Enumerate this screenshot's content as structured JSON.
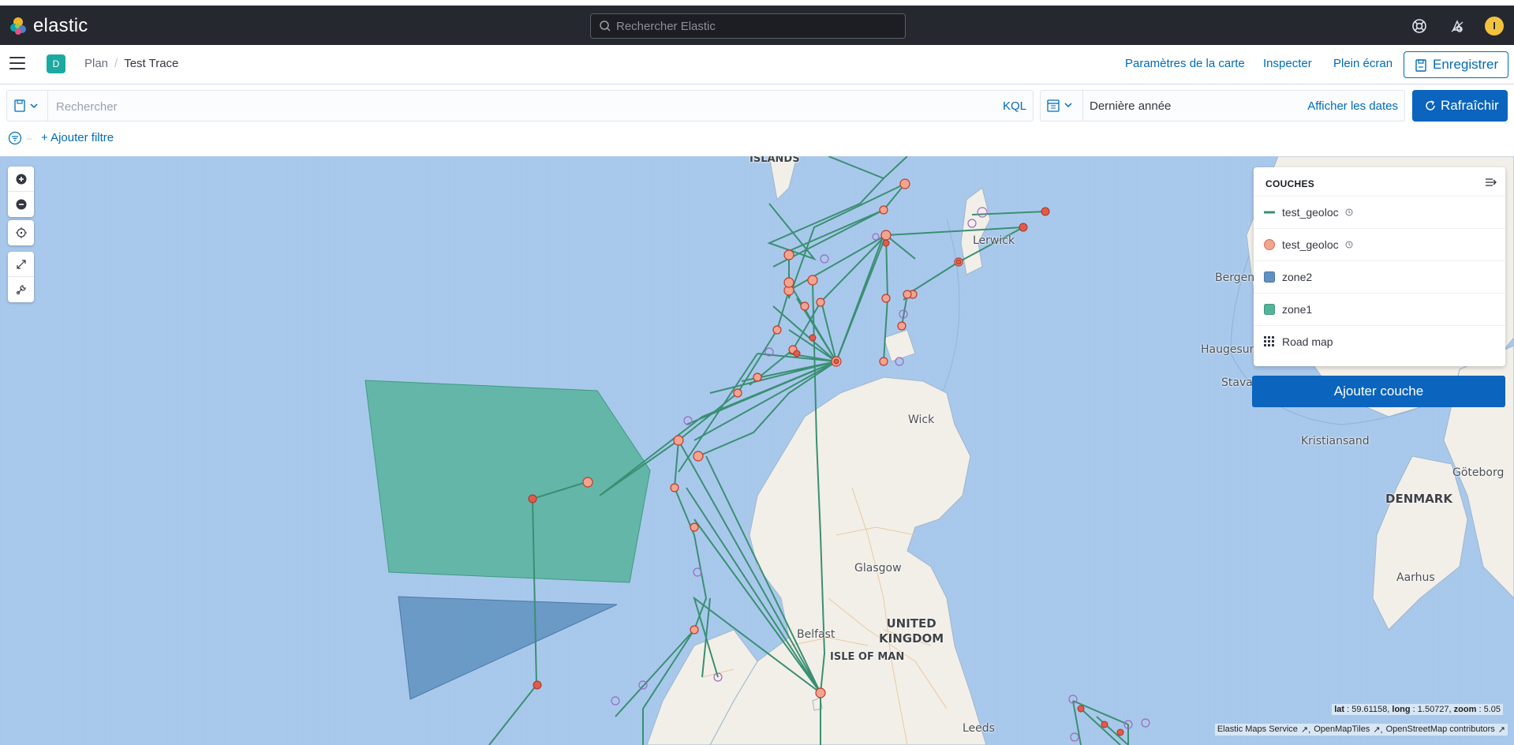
{
  "app": {
    "brand": "elastic",
    "search_placeholder": "Rechercher Elastic",
    "avatar_initial": "I",
    "space_initial": "D"
  },
  "breadcrumb": {
    "parent": "Plan",
    "current": "Test Trace"
  },
  "header_actions": {
    "map_settings": "Paramètres de la carte",
    "inspect": "Inspecter",
    "fullscreen": "Plein écran",
    "save": "Enregistrer"
  },
  "query": {
    "placeholder": "Rechercher",
    "language": "KQL",
    "date_range": "Dernière année",
    "show_dates": "Afficher les dates",
    "refresh": "Rafraîchir",
    "add_filter": "+ Ajouter filtre"
  },
  "map": {
    "layers_title": "COUCHES",
    "layers": [
      {
        "name": "test_geoloc",
        "icon": "line-icon",
        "time_aware": true
      },
      {
        "name": "test_geoloc",
        "icon": "point-icon",
        "time_aware": true
      },
      {
        "name": "zone2",
        "icon": "polygon-icon"
      },
      {
        "name": "zone1",
        "icon": "polygon-icon"
      },
      {
        "name": "Road map",
        "icon": "grid-icon"
      }
    ],
    "add_layer": "Ajouter couche",
    "colors": {
      "zone1": "#54b399",
      "zone2": "#6092c0",
      "track": "#3a8f73",
      "point_fill": "#f0a58f",
      "water": "#a9c9ec",
      "land": "#f2efe8"
    },
    "place_labels": {
      "islands": "ISLANDS",
      "lerwick": "Lerwick",
      "bergen": "Bergen",
      "haugesund": "Haugesun",
      "stavanger": "Stavar",
      "wick": "Wick",
      "kristiansand": "Kristiansand",
      "goteborg": "Göteborg",
      "glasgow": "Glasgow",
      "aarhus": "Aarhus",
      "denmark": "DENMARK",
      "united_kingdom": "UNITED\nKINGDOM",
      "belfast": "Belfast",
      "isle_of_man": "ISLE OF MAN",
      "leeds": "Leeds"
    },
    "coords_label": {
      "lat_key": "lat",
      "lat": "59.61158,",
      "long_key": "long",
      "long": "1.50727,",
      "zoom_key": "zoom",
      "zoom": "5.05"
    },
    "attribution": [
      "Elastic Maps Service",
      "OpenMapTiles",
      "OpenStreetMap contributors"
    ]
  }
}
